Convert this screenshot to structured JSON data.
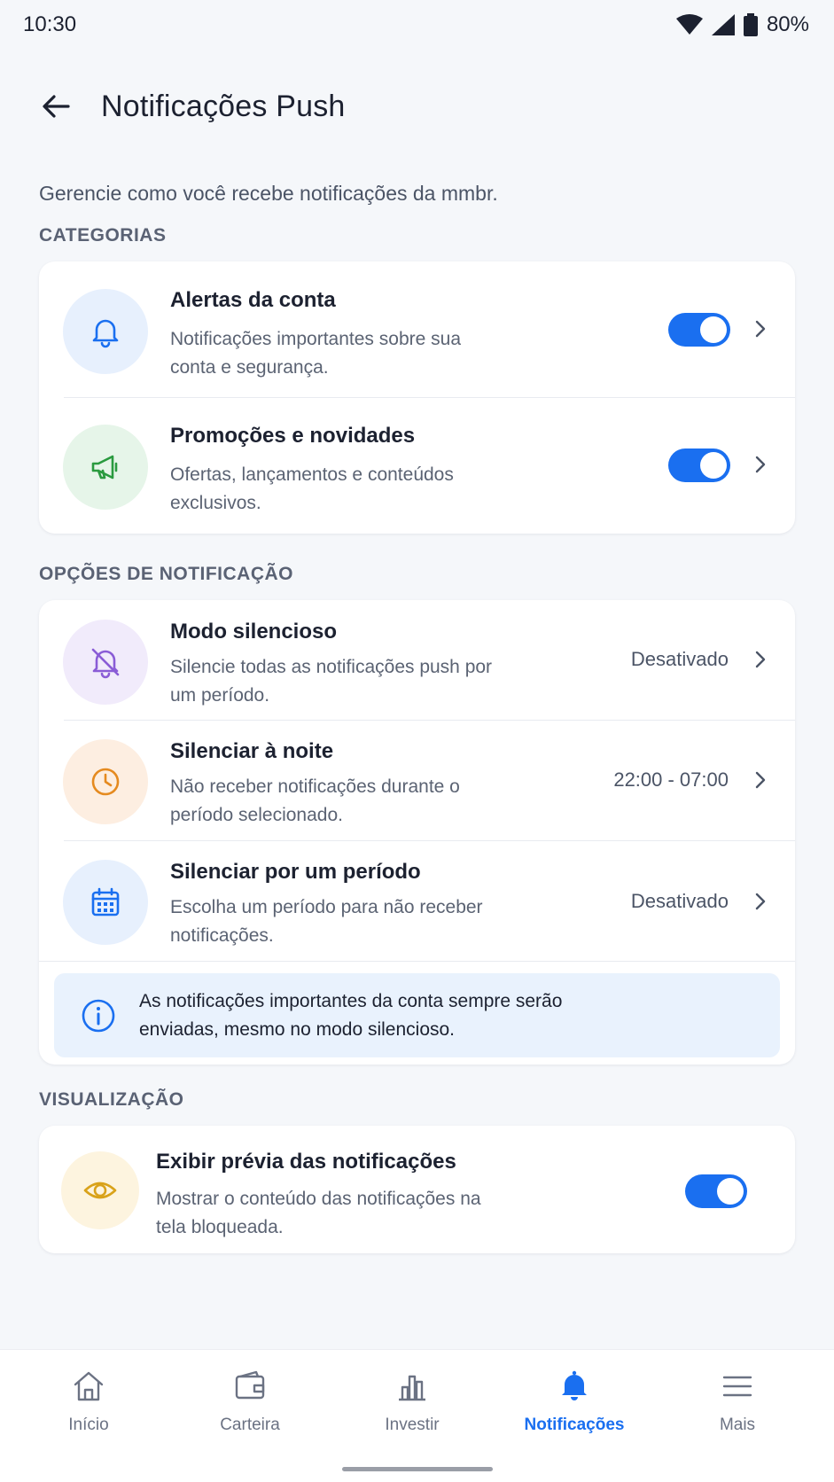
{
  "status_bar": {
    "time": "10:30",
    "battery": "80%"
  },
  "header": {
    "title": "Notificações Push"
  },
  "intro": "Gerencie como você recebe notificações da mmbr.",
  "sections": {
    "categories": {
      "label": "CATEGORIAS",
      "items": [
        {
          "title": "Alertas da conta",
          "subtitle": "Notificações importantes sobre sua conta e segurança.",
          "icon": "bell-icon",
          "enabled": true,
          "color": "#1a6ff0"
        },
        {
          "title": "Promoções e novidades",
          "subtitle": "Ofertas, lançamentos e conteúdos exclusivos.",
          "icon": "megaphone-icon",
          "enabled": true,
          "color": "#2a9a3f"
        }
      ]
    },
    "options": {
      "label": "OPÇÕES DE NOTIFICAÇÃO",
      "items": [
        {
          "title": "Modo silencioso",
          "subtitle": "Silencie todas as notificações push por um período.",
          "value": "Desativado",
          "icon": "bell-off-icon",
          "color": "#8a5cd6"
        },
        {
          "title": "Silenciar à noite",
          "subtitle": "Não receber notificações durante o período selecionado.",
          "value": "22:00 - 07:00",
          "icon": "clock-icon",
          "color": "#e58a1f"
        },
        {
          "title": "Silenciar por um período",
          "subtitle": "Escolha um período para não receber notificações.",
          "value": "Desativado",
          "icon": "calendar-icon",
          "color": "#1a6ff0"
        }
      ],
      "info": "As notificações importantes da conta sempre serão enviadas, mesmo no modo silencioso."
    },
    "view": {
      "label": "VISUALIZAÇÃO",
      "items": [
        {
          "title": "Exibir prévia das notificações",
          "subtitle": "Mostrar o conteúdo das notificações na tela bloqueada.",
          "icon": "eye-icon",
          "enabled": true,
          "color": "#d9a21a"
        }
      ]
    }
  },
  "bottom_nav": {
    "items": [
      {
        "label": "Início",
        "icon": "home-icon"
      },
      {
        "label": "Carteira",
        "icon": "wallet-icon"
      },
      {
        "label": "Investir",
        "icon": "bar-chart-icon"
      },
      {
        "label": "Notificações",
        "icon": "bell-icon",
        "active": true
      },
      {
        "label": "Mais",
        "icon": "menu-icon"
      }
    ]
  },
  "colors": {
    "accent": "#1a6ff0",
    "background": "#f5f7fa"
  }
}
